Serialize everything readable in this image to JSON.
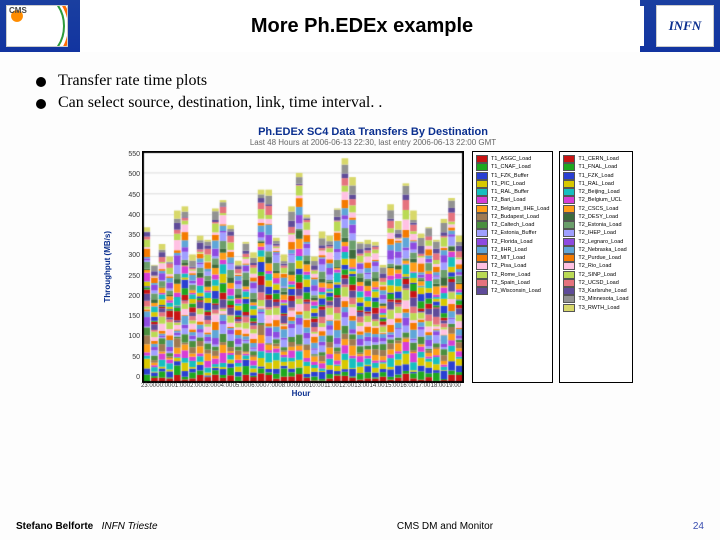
{
  "header": {
    "title": "More Ph.EDEx example",
    "logo_left_label": "CMS",
    "logo_right_label": "INFN"
  },
  "bullets": [
    "Transfer rate time plots",
    "Can select source, destination, link, time interval. ."
  ],
  "chart_data": {
    "type": "bar",
    "stacked": true,
    "title": "Ph.EDEx SC4 Data Transfers By Destination",
    "subtitle": "Last 48 Hours at 2006-06-13 22:30, last entry 2006-06-13 22:00 GMT",
    "xlabel": "Hour",
    "ylabel": "Throughput (MB/s)",
    "ylim": [
      0,
      550
    ],
    "yticks": [
      0,
      50,
      100,
      150,
      200,
      250,
      300,
      350,
      400,
      450,
      500,
      550
    ],
    "categories": [
      "23:00",
      "00:00",
      "01:00",
      "02:00",
      "03:00",
      "04:00",
      "05:00",
      "06:00",
      "07:00",
      "08:00",
      "09:00",
      "10:00",
      "11:00",
      "12:00",
      "13:00",
      "14:00",
      "15:00",
      "16:00",
      "17:00",
      "18:00",
      "19:00"
    ],
    "totals": [
      370,
      280,
      330,
      300,
      410,
      420,
      305,
      350,
      340,
      415,
      435,
      375,
      290,
      335,
      310,
      460,
      460,
      345,
      305,
      420,
      500,
      400,
      300,
      360,
      350,
      415,
      535,
      490,
      335,
      340,
      335,
      280,
      425,
      385,
      475,
      410,
      355,
      370,
      340,
      390,
      440,
      350
    ],
    "series": [
      {
        "name": "T1_ASGC_Load",
        "color": "#c81414"
      },
      {
        "name": "T1_CNAF_Load",
        "color": "#1ea81e"
      },
      {
        "name": "T1_FZK_Buffer",
        "color": "#2a3fd2"
      },
      {
        "name": "T1_PIC_Load",
        "color": "#d8c800"
      },
      {
        "name": "T1_RAL_Buffer",
        "color": "#16bfbf"
      },
      {
        "name": "T2_Bari_Load",
        "color": "#d63ed6"
      },
      {
        "name": "T2_Belgium_IIHE_Load",
        "color": "#ff9e18"
      },
      {
        "name": "T2_Budapest_Load",
        "color": "#9f7a52"
      },
      {
        "name": "T2_Caltech_Load",
        "color": "#4a8f3e"
      },
      {
        "name": "T2_Estonia_Buffer",
        "color": "#a0a0ff"
      },
      {
        "name": "T2_Florida_Load",
        "color": "#8e4ae0"
      },
      {
        "name": "T2_IIHR_Load",
        "color": "#5fa6d8"
      },
      {
        "name": "T2_MIT_Load",
        "color": "#f47a00"
      },
      {
        "name": "T2_Pisa_Load",
        "color": "#ffc1e3"
      },
      {
        "name": "T2_Rome_Load",
        "color": "#bada55"
      },
      {
        "name": "T2_Spain_Load",
        "color": "#e5737e"
      },
      {
        "name": "T2_Wisconsin_Load",
        "color": "#5f4b99"
      },
      {
        "name": "T1_CERN_Load",
        "color": "#c81414"
      },
      {
        "name": "T1_FNAL_Load",
        "color": "#1ea81e"
      },
      {
        "name": "T1_FZK_Load",
        "color": "#2a3fd2"
      },
      {
        "name": "T1_RAL_Load",
        "color": "#d8c800"
      },
      {
        "name": "T2_Beijing_Load",
        "color": "#16bfbf"
      },
      {
        "name": "T2_Belgium_UCL",
        "color": "#d63ed6"
      },
      {
        "name": "T2_CSCS_Load",
        "color": "#ff9e18"
      },
      {
        "name": "T2_DESY_Load",
        "color": "#3c6b3c"
      },
      {
        "name": "T2_Estonia_Load",
        "color": "#6b9e6b"
      },
      {
        "name": "T2_IHEP_Load",
        "color": "#a0a0ff"
      },
      {
        "name": "T2_Legnaro_Load",
        "color": "#8e4ae0"
      },
      {
        "name": "T2_Nebraska_Load",
        "color": "#5fa6d8"
      },
      {
        "name": "T2_Purdue_Load",
        "color": "#f47a00"
      },
      {
        "name": "T2_Rio_Load",
        "color": "#ffc1e3"
      },
      {
        "name": "T2_SINP_Load",
        "color": "#bada55"
      },
      {
        "name": "T2_UCSD_Load",
        "color": "#e5737e"
      },
      {
        "name": "T3_Karlsruhe_Load",
        "color": "#5f4b99"
      },
      {
        "name": "T3_Minnesota_Load",
        "color": "#929292"
      },
      {
        "name": "T3_RWTH_Load",
        "color": "#d8d86a"
      }
    ]
  },
  "footer": {
    "author": "Stefano Belforte",
    "affiliation": "INFN Trieste",
    "center": "CMS DM and Monitor",
    "page": "24"
  }
}
